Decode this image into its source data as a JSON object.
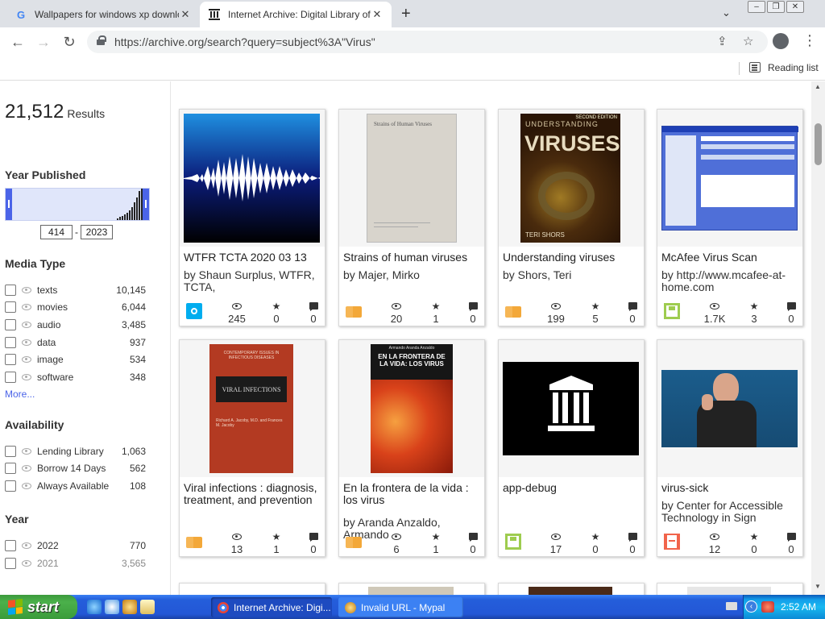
{
  "browser": {
    "tabs": [
      {
        "title": "Wallpapers for windows xp downloa",
        "favicon": "G",
        "active": false
      },
      {
        "title": "Internet Archive: Digital Library of F",
        "favicon": "archive-icon",
        "active": true
      }
    ],
    "new_tab_symbol": "+",
    "url": "https://archive.org/search?query=subject%3A\"Virus\"",
    "reading_list_label": "Reading list",
    "window_controls": [
      "minimize",
      "restore",
      "close"
    ]
  },
  "sidebar": {
    "results_count": "21,512",
    "results_label": "Results",
    "year_published": {
      "title": "Year Published",
      "min": "414",
      "separator": "-",
      "max": "2023"
    },
    "media_type": {
      "title": "Media Type",
      "items": [
        {
          "label": "texts",
          "count": "10,145"
        },
        {
          "label": "movies",
          "count": "6,044"
        },
        {
          "label": "audio",
          "count": "3,485"
        },
        {
          "label": "data",
          "count": "937"
        },
        {
          "label": "image",
          "count": "534"
        },
        {
          "label": "software",
          "count": "348"
        }
      ],
      "more": "More..."
    },
    "availability": {
      "title": "Availability",
      "items": [
        {
          "label": "Lending Library",
          "count": "1,063"
        },
        {
          "label": "Borrow 14 Days",
          "count": "562"
        },
        {
          "label": "Always Available",
          "count": "108"
        }
      ]
    },
    "year": {
      "title": "Year",
      "items": [
        {
          "label": "2022",
          "count": "770"
        },
        {
          "label": "2021",
          "count": "3,565"
        }
      ]
    }
  },
  "results": [
    {
      "title": "WTFR TCTA 2020 03 13",
      "by": "by Shaun Surplus, WTFR, TCTA,",
      "media": "audio",
      "views": "245",
      "favs": "0",
      "reviews": "0"
    },
    {
      "title": "Strains of human viruses",
      "by": "by Majer, Mirko",
      "media": "texts",
      "views": "20",
      "favs": "1",
      "reviews": "0"
    },
    {
      "title": "Understanding viruses",
      "by": "by Shors, Teri",
      "media": "texts",
      "views": "199",
      "favs": "5",
      "reviews": "0"
    },
    {
      "title": "McAfee Virus Scan",
      "by": "by http://www.mcafee-at-home.com",
      "media": "software",
      "views": "1.7K",
      "favs": "3",
      "reviews": "0"
    },
    {
      "title": "Viral infections : diagnosis, treatment, and prevention",
      "by": "",
      "media": "texts",
      "views": "13",
      "favs": "1",
      "reviews": "0"
    },
    {
      "title": "En la frontera de la vida : los virus",
      "by": "by Aranda Anzaldo, Armando",
      "media": "texts",
      "views": "6",
      "favs": "1",
      "reviews": "0"
    },
    {
      "title": "app-debug",
      "by": "",
      "media": "software",
      "views": "17",
      "favs": "0",
      "reviews": "0"
    },
    {
      "title": "virus-sick",
      "by": "by Center for Accessible Technology in Sign",
      "media": "movies",
      "views": "12",
      "favs": "0",
      "reviews": "0"
    }
  ],
  "thumb_text": {
    "book2_cover": "Strains of Human Viruses",
    "book3_top": "UNDERSTANDING",
    "book3_main": "VIRUSES",
    "book3_author": "TERI SHORS",
    "book3_edition": "SECOND EDITION",
    "book5_top": "CONTEMPORARY ISSUES IN INFECTIOUS DISEASES",
    "book5_title": "VIRAL INFECTIONS",
    "book5_authors": "Richard A. Jacoby, M.D. and Frances M. Jacoby",
    "book6_author": "Armando Aranda Anzaldo",
    "book6_title": "EN LA FRONTERA DE LA VIDA: LOS VIRUS"
  },
  "taskbar": {
    "start_label": "start",
    "items": [
      {
        "label": "Internet Archive: Digi...",
        "active": true
      },
      {
        "label": "Invalid URL - Mypal",
        "active": false
      }
    ],
    "clock": "2:52 AM"
  },
  "colors": {
    "accent": "#4b64e8",
    "audio": "#00adef",
    "texts": "#f3a839",
    "software": "#9ecc4f",
    "movies": "#f1644b",
    "taskbar": "#245edb",
    "start": "#3c9a3c"
  }
}
